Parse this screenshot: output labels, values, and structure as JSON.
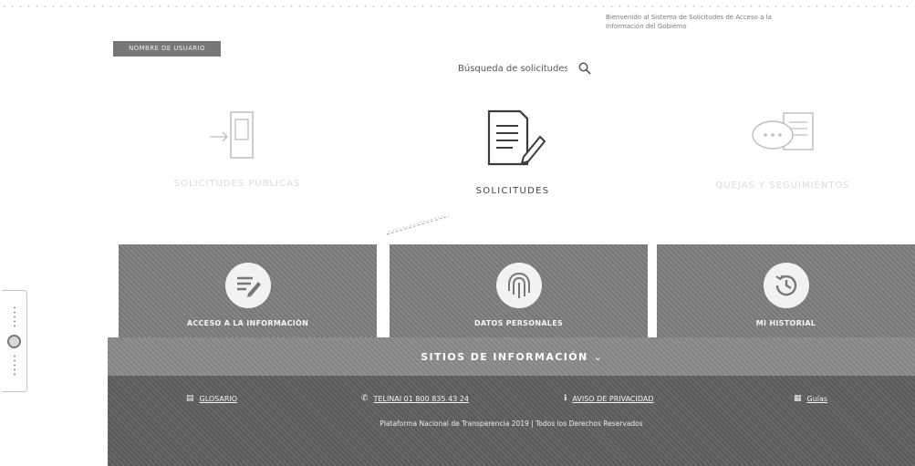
{
  "header": {
    "note_line1": "Bienvenido al Sistema de Solicitudes de Acceso a la",
    "note_line2": "Información del Gobierno",
    "user_badge": "NOMBRE DE USUARIO"
  },
  "search": {
    "value": "Búsqueda de solicitudes"
  },
  "categories": [
    {
      "label": "SOLICITUDES PÚBLICAS",
      "icon": "door-arrow-icon",
      "state": "faded"
    },
    {
      "label": "SOLICITUDES",
      "icon": "document-pen-icon",
      "state": "active"
    },
    {
      "label": "QUEJAS Y SEGUIMIENTOS",
      "icon": "chat-bubbles-icon",
      "state": "faded"
    }
  ],
  "panels": [
    {
      "label": "ACCESO A LA INFORMACIÓN",
      "icon": "edit-list-icon"
    },
    {
      "label": "DATOS PERSONALES",
      "icon": "fingerprint-icon"
    },
    {
      "label": "MI HISTORIAL",
      "icon": "history-clock-icon"
    }
  ],
  "sitios": {
    "label": "SITIOS DE INFORMACIÓN",
    "icon": "chevron-down-icon"
  },
  "footer": {
    "links": [
      {
        "label": "GLOSARIO",
        "icon": "glossary-icon"
      },
      {
        "label": "TELINAI 01 800 835 43 24",
        "icon": "phone-icon"
      },
      {
        "label": "AVISO DE PRIVACIDAD",
        "icon": "info-icon"
      },
      {
        "label": "Guías",
        "icon": "guide-icon"
      }
    ],
    "copyright": "Plataforma Nacional de Transparencia 2019 | Todos los Derechos Reservados"
  },
  "colors": {
    "panel": "#7d7d7d",
    "sitios_bar": "#8a8a8a",
    "footer": "#5f5f5f",
    "text_dark": "#444444"
  }
}
